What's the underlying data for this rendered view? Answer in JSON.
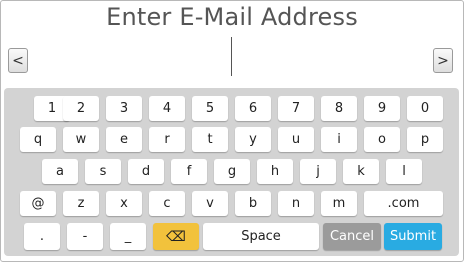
{
  "title": "Enter E-Mail Address",
  "input": {
    "value": ""
  },
  "nav": {
    "left": "<",
    "right": ">"
  },
  "keyboard": {
    "row1": [
      "1",
      "2",
      "3",
      "4",
      "5",
      "6",
      "7",
      "8",
      "9",
      "0"
    ],
    "row2": [
      "q",
      "w",
      "e",
      "r",
      "t",
      "y",
      "u",
      "i",
      "o",
      "p"
    ],
    "row3": [
      "a",
      "s",
      "d",
      "f",
      "g",
      "h",
      "j",
      "k",
      "l"
    ],
    "row4": [
      "@",
      "z",
      "x",
      "c",
      "v",
      "b",
      "n",
      "m",
      ".com"
    ],
    "row5": {
      "dot": ".",
      "dash": "-",
      "underscore": "_",
      "backspace": "⌫",
      "space": "Space",
      "cancel": "Cancel",
      "submit": "Submit"
    }
  },
  "colors": {
    "backspace": "#f2c23c",
    "cancel": "#9b9b9b",
    "submit": "#29abe2",
    "keyboard_bg": "#d3d3d3"
  }
}
